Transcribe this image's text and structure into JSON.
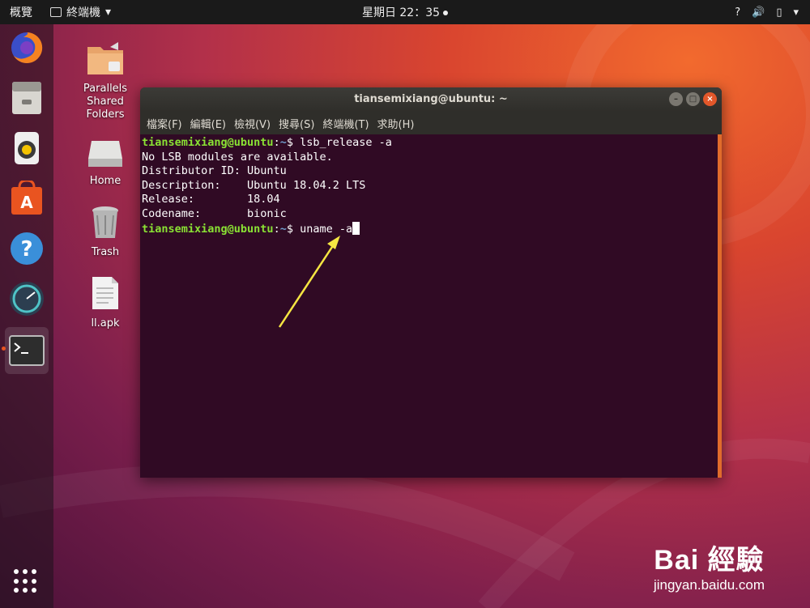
{
  "topbar": {
    "activities": "概覽",
    "app_name": "終端機",
    "app_arrow": "▾",
    "clock": "星期日 22：35",
    "net_icon": "?",
    "volume_icon": "🔊",
    "battery_icon": "▯",
    "menu_arrow": "▾"
  },
  "desktop": {
    "items": [
      {
        "label": "Parallels\nShared\nFolders"
      },
      {
        "label": "Home"
      },
      {
        "label": "Trash"
      },
      {
        "label": "ll.apk"
      }
    ]
  },
  "terminal": {
    "title": "tiansemixiang@ubuntu: ~",
    "menu": [
      "檔案(F)",
      "編輯(E)",
      "檢視(V)",
      "搜尋(S)",
      "終端機(T)",
      "求助(H)"
    ],
    "prompt_user": "tiansemixiang@ubuntu",
    "prompt_sep": ":",
    "prompt_path": "~",
    "prompt_end": "$ ",
    "cmd1": "lsb_release -a",
    "output": [
      "No LSB modules are available.",
      "Distributor ID:\tUbuntu",
      "Description:\tUbuntu 18.04.2 LTS",
      "Release:\t18.04",
      "Codename:\tbionic"
    ],
    "cmd2": "uname -a"
  },
  "watermark": {
    "logo": "Bai 經驗",
    "url": "jingyan.baidu.com"
  },
  "colors": {
    "prompt_user": "#8ae234",
    "prompt_path": "#729fcf",
    "terminal_bg": "#300a24",
    "accent": "#e95420"
  }
}
